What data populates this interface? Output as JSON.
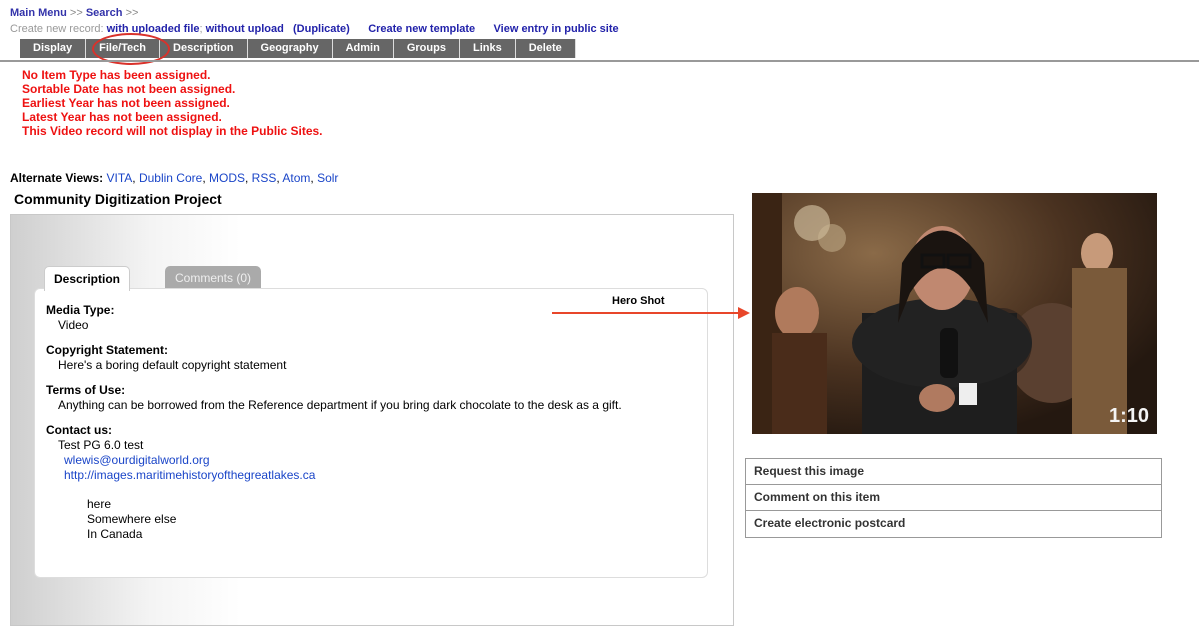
{
  "breadcrumb": {
    "main_menu": "Main Menu",
    "sep1": ">>",
    "search": "Search",
    "sep2": ">>"
  },
  "create": {
    "prefix": "Create new record:",
    "with_upload": "with uploaded file",
    "semi": ";",
    "without_upload": "without upload",
    "duplicate": "(Duplicate)",
    "new_template": "Create new template",
    "view_public": "View entry in public site"
  },
  "tabs": [
    "Display",
    "File/Tech",
    "Description",
    "Geography",
    "Admin",
    "Groups",
    "Links",
    "Delete"
  ],
  "warnings": [
    "No Item Type has been assigned.",
    "Sortable Date has not been assigned.",
    "Earliest Year has not been assigned.",
    "Latest Year has not been assigned.",
    "This Video record will not display in the Public Sites."
  ],
  "alternate_views": {
    "label": "Alternate Views:",
    "links": [
      "VITA",
      "Dublin Core",
      "MODS",
      "RSS",
      "Atom",
      "Solr"
    ]
  },
  "record_title": "Community Digitization Project",
  "panel_tabs": {
    "description": "Description",
    "comments": "Comments (0)"
  },
  "fields": {
    "media_type": {
      "label": "Media Type:",
      "value": "Video"
    },
    "copyright": {
      "label": "Copyright Statement:",
      "value": "Here's a boring default copyright statement"
    },
    "terms": {
      "label": "Terms of Use:",
      "value": "Anything can be borrowed from the Reference department if you bring dark chocolate to the desk as a gift."
    },
    "contact": {
      "label": "Contact us:",
      "name": "Test PG 6.0 test",
      "email": "wlewis@ourdigitalworld.org",
      "url": "http://images.maritimehistoryofthegreatlakes.ca",
      "address": [
        "here",
        "Somewhere else",
        "In Canada"
      ]
    }
  },
  "hero_label": "Hero Shot",
  "video": {
    "duration": "1:10"
  },
  "actions": [
    "Request this image",
    "Comment on this item",
    "Create electronic postcard"
  ],
  "colors": {
    "warning": "#ee1111",
    "link": "#1a45c8",
    "tab_bg": "#666666",
    "annotation": "#e8462a"
  }
}
